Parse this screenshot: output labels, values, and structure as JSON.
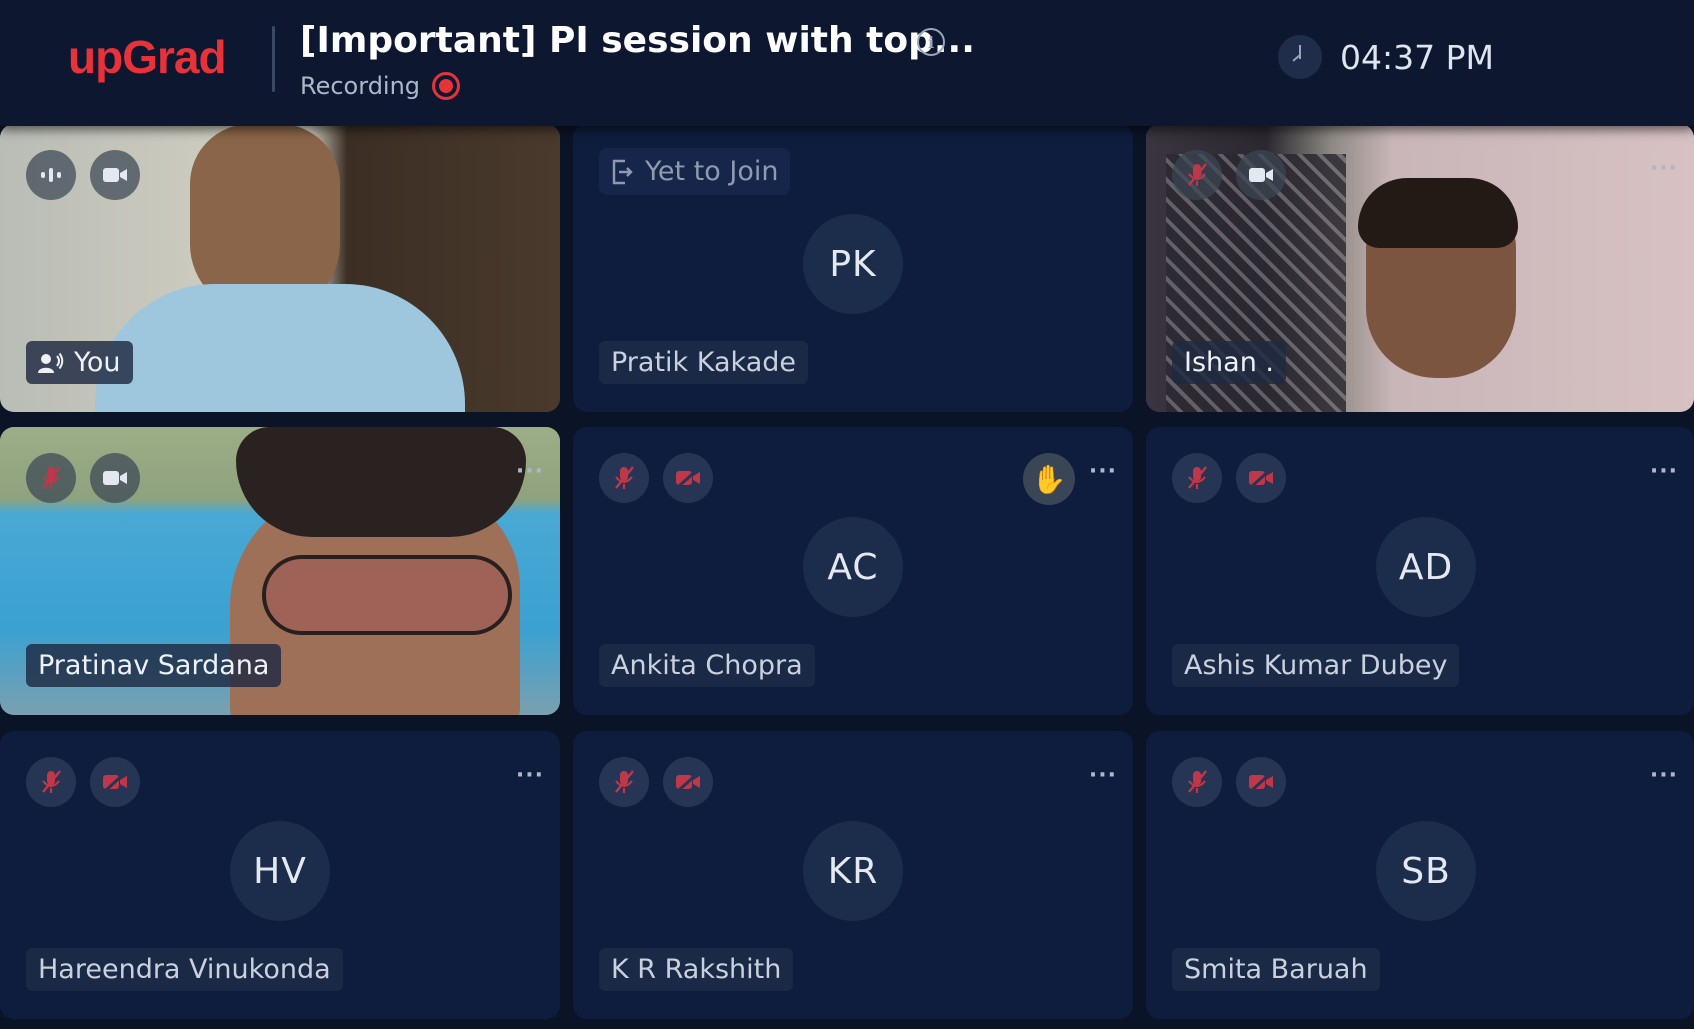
{
  "header": {
    "logo": "upGrad",
    "title": "[Important] PI session with top...",
    "recording_label": "Recording",
    "time": "04:37 PM"
  },
  "colors": {
    "brand": "#e8323a",
    "background": "#0b1426",
    "tile": "#0e1d3d",
    "muted_icon": "#c0374a"
  },
  "participants": [
    {
      "name": "You",
      "video": true,
      "mic": "speaking",
      "camera": "on"
    },
    {
      "name": "Pratik Kakade",
      "initials": "PK",
      "status": "Yet to Join"
    },
    {
      "name": "Ishan .",
      "video": true,
      "mic": "muted",
      "camera": "on"
    },
    {
      "name": "Pratinav Sardana",
      "video": true,
      "mic": "muted",
      "camera": "on"
    },
    {
      "name": "Ankita Chopra",
      "initials": "AC",
      "mic": "muted",
      "camera": "off",
      "hand_raised": true
    },
    {
      "name": "Ashis Kumar Dubey",
      "initials": "AD",
      "mic": "muted",
      "camera": "off"
    },
    {
      "name": "Hareendra Vinukonda",
      "initials": "HV",
      "mic": "muted",
      "camera": "off"
    },
    {
      "name": "K R Rakshith",
      "initials": "KR",
      "mic": "muted",
      "camera": "off"
    },
    {
      "name": "Smita Baruah",
      "initials": "SB",
      "mic": "muted",
      "camera": "off"
    }
  ],
  "icons": {
    "info": "info-icon",
    "clock": "clock-icon",
    "more": "more-options-icon",
    "hand": "raised-hand-icon"
  },
  "more_glyph": "···"
}
